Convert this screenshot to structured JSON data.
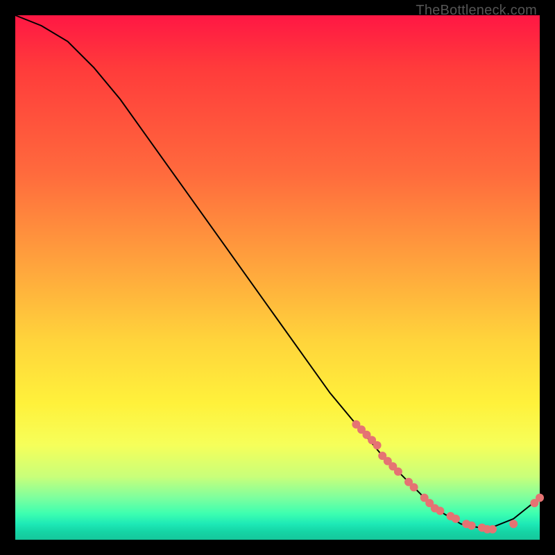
{
  "watermark": "TheBottleneck.com",
  "chart_data": {
    "type": "line",
    "title": "",
    "xlabel": "",
    "ylabel": "",
    "xlim": [
      0,
      100
    ],
    "ylim": [
      0,
      100
    ],
    "grid": false,
    "legend": false,
    "series": [
      {
        "name": "curve",
        "color": "#000000",
        "x": [
          0,
          5,
          10,
          15,
          20,
          25,
          30,
          35,
          40,
          45,
          50,
          55,
          60,
          65,
          70,
          75,
          80,
          85,
          90,
          95,
          100
        ],
        "values": [
          100,
          98,
          95,
          90,
          84,
          77,
          70,
          63,
          56,
          49,
          42,
          35,
          28,
          22,
          16,
          11,
          6,
          3,
          2,
          4,
          8
        ]
      }
    ],
    "scatter_points": {
      "name": "markers",
      "color": "#e57373",
      "radius_px": 6,
      "x": [
        65,
        66,
        67,
        68,
        69,
        70,
        71,
        72,
        73,
        75,
        76,
        78,
        79,
        80,
        81,
        83,
        84,
        86,
        87,
        89,
        90,
        91,
        95,
        99,
        100
      ],
      "values": [
        22,
        21,
        20,
        19,
        18,
        16,
        15,
        14,
        13,
        11,
        10,
        8,
        7,
        6,
        5.5,
        4.5,
        4,
        3,
        2.7,
        2.3,
        2,
        2,
        3,
        7,
        8
      ]
    },
    "background_gradient": {
      "direction": "vertical",
      "stops": [
        {
          "pos": 0,
          "color": "#ff1744"
        },
        {
          "pos": 30,
          "color": "#ff6a3d"
        },
        {
          "pos": 60,
          "color": "#ffd43b"
        },
        {
          "pos": 82,
          "color": "#f6ff5a"
        },
        {
          "pos": 92,
          "color": "#7dff9e"
        },
        {
          "pos": 100,
          "color": "#15c79b"
        }
      ]
    }
  }
}
